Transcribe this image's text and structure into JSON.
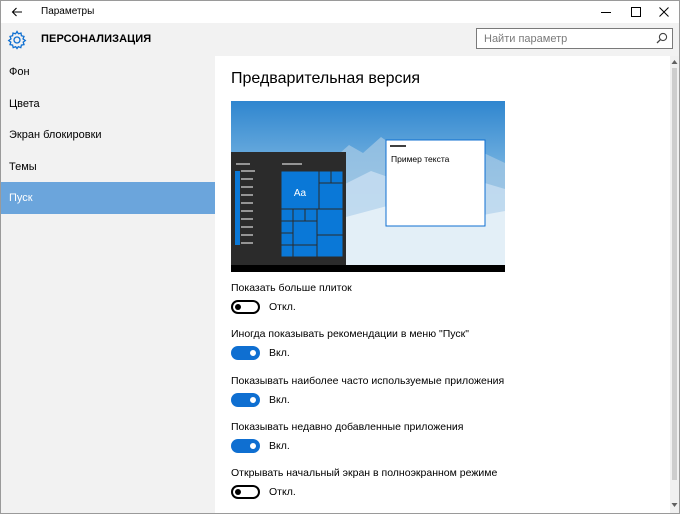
{
  "window": {
    "title": "Параметры"
  },
  "header": {
    "title": "ПЕРСОНАЛИЗАЦИЯ",
    "search_placeholder": "Найти параметр"
  },
  "sidebar": {
    "items": [
      {
        "label": "Фон",
        "active": false
      },
      {
        "label": "Цвета",
        "active": false
      },
      {
        "label": "Экран блокировки",
        "active": false
      },
      {
        "label": "Темы",
        "active": false
      },
      {
        "label": "Пуск",
        "active": true
      }
    ]
  },
  "main": {
    "title": "Предварительная версия",
    "preview": {
      "sample_text": "Пример текста",
      "tile_label": "Aa"
    },
    "toggles": [
      {
        "label": "Показать больше плиток",
        "state": "Откл.",
        "on": false
      },
      {
        "label": "Иногда показывать рекомендации в меню \"Пуск\"",
        "state": "Вкл.",
        "on": true
      },
      {
        "label": "Показывать наиболее часто используемые приложения",
        "state": "Вкл.",
        "on": true
      },
      {
        "label": "Показывать недавно добавленные приложения",
        "state": "Вкл.",
        "on": true
      },
      {
        "label": "Открывать начальный экран в полноэкранном режиме",
        "state": "Откл.",
        "on": false
      }
    ]
  },
  "colors": {
    "accent": "#0f6fd1",
    "sidebar_active": "#6ba5dc",
    "sidebar_bg": "#f2f2f2",
    "tile_blue": "#0a78d7"
  }
}
